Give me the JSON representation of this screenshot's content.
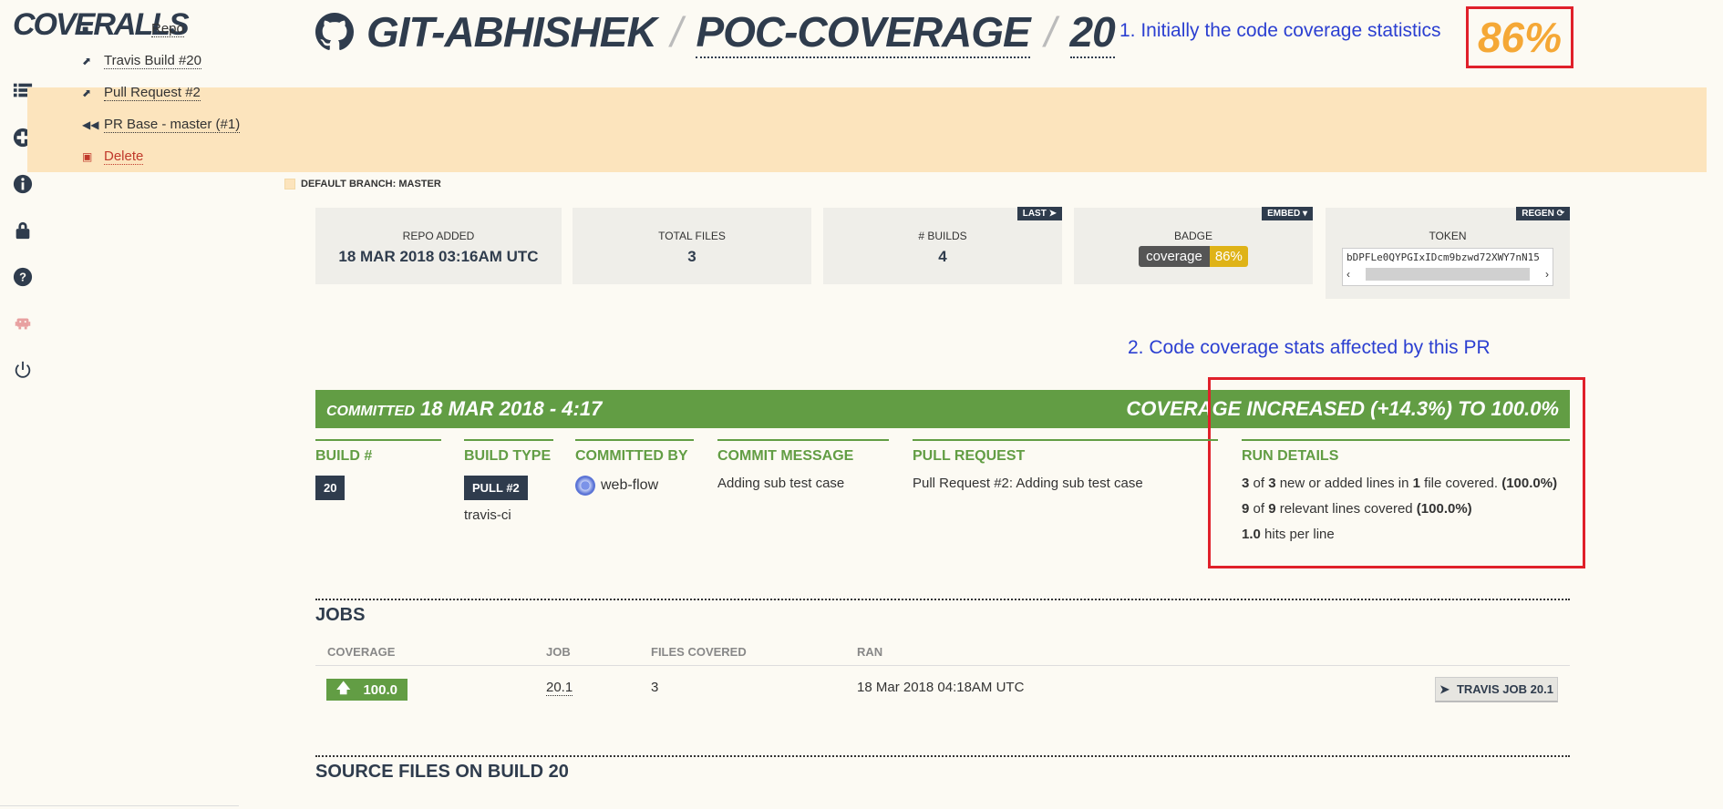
{
  "logo": "COVERALLS",
  "menu": {
    "items": [
      {
        "label": "Repo",
        "icon": "repo-icon"
      },
      {
        "label": "Travis Build #20",
        "icon": "external-link-icon"
      },
      {
        "label": "Pull Request #2",
        "icon": "external-link-icon"
      },
      {
        "label": "PR Base - master (#1)",
        "icon": "rewind-icon"
      },
      {
        "label": "Delete",
        "icon": "trash-icon"
      }
    ]
  },
  "header": {
    "owner": "GIT-ABHISHEK",
    "repo": "POC-COVERAGE",
    "build": "20",
    "sep": "/"
  },
  "annotations": {
    "note1": "1. Initially the code coverage statistics",
    "coverage_pct": "86%",
    "note2": "2. Code coverage stats affected by this PR"
  },
  "branch": "DEFAULT BRANCH: MASTER",
  "stats": {
    "repo_added_label": "REPO ADDED",
    "repo_added": "18 MAR 2018 03:16AM UTC",
    "total_files_label": "TOTAL FILES",
    "total_files": "3",
    "builds_label": "# BUILDS",
    "builds": "4",
    "builds_tag": "LAST",
    "badge_label": "BADGE",
    "badge_tag": "EMBED",
    "badge_left": "coverage",
    "badge_right": "86%",
    "token_label": "TOKEN",
    "token_tag": "REGEN",
    "token": "bDPFLe0QYPGIxIDcm9bzwd72XWY7nN15"
  },
  "commit": {
    "committed_label": "COMMITTED",
    "committed_date": "18 MAR 2018 - 4:17",
    "summary": "COVERAGE INCREASED (+14.3%) TO 100.0%",
    "build_label": "BUILD #",
    "build_num": "20",
    "build_type_label": "BUILD TYPE",
    "build_type_pill": "PULL #2",
    "build_type": "travis-ci",
    "committed_by_label": "COMMITTED BY",
    "committed_by": "web-flow",
    "message_label": "COMMIT MESSAGE",
    "message": "Adding sub test case",
    "pr_label": "PULL REQUEST",
    "pr": "Pull Request #2: Adding sub test case",
    "run_details_label": "RUN DETAILS",
    "rd1": {
      "a": "3",
      "of": " of ",
      "b": "3",
      "mid": " new or added lines in ",
      "c": "1",
      "end": " file covered. ",
      "pct": "(100.0%)"
    },
    "rd2": {
      "a": "9",
      "of": " of ",
      "b": "9",
      "mid": " relevant lines covered ",
      "pct": "(100.0%)"
    },
    "rd3": {
      "a": "1.0",
      "end": " hits per line"
    }
  },
  "jobs": {
    "title": "JOBS",
    "headers": [
      "COVERAGE",
      "JOB",
      "FILES COVERED",
      "RAN"
    ],
    "row": {
      "coverage": "100.0",
      "job": "20.1",
      "files": "3",
      "ran": "18 Mar 2018 04:18AM UTC",
      "button": "TRAVIS JOB 20.1"
    }
  },
  "source_title": "SOURCE FILES ON BUILD 20"
}
